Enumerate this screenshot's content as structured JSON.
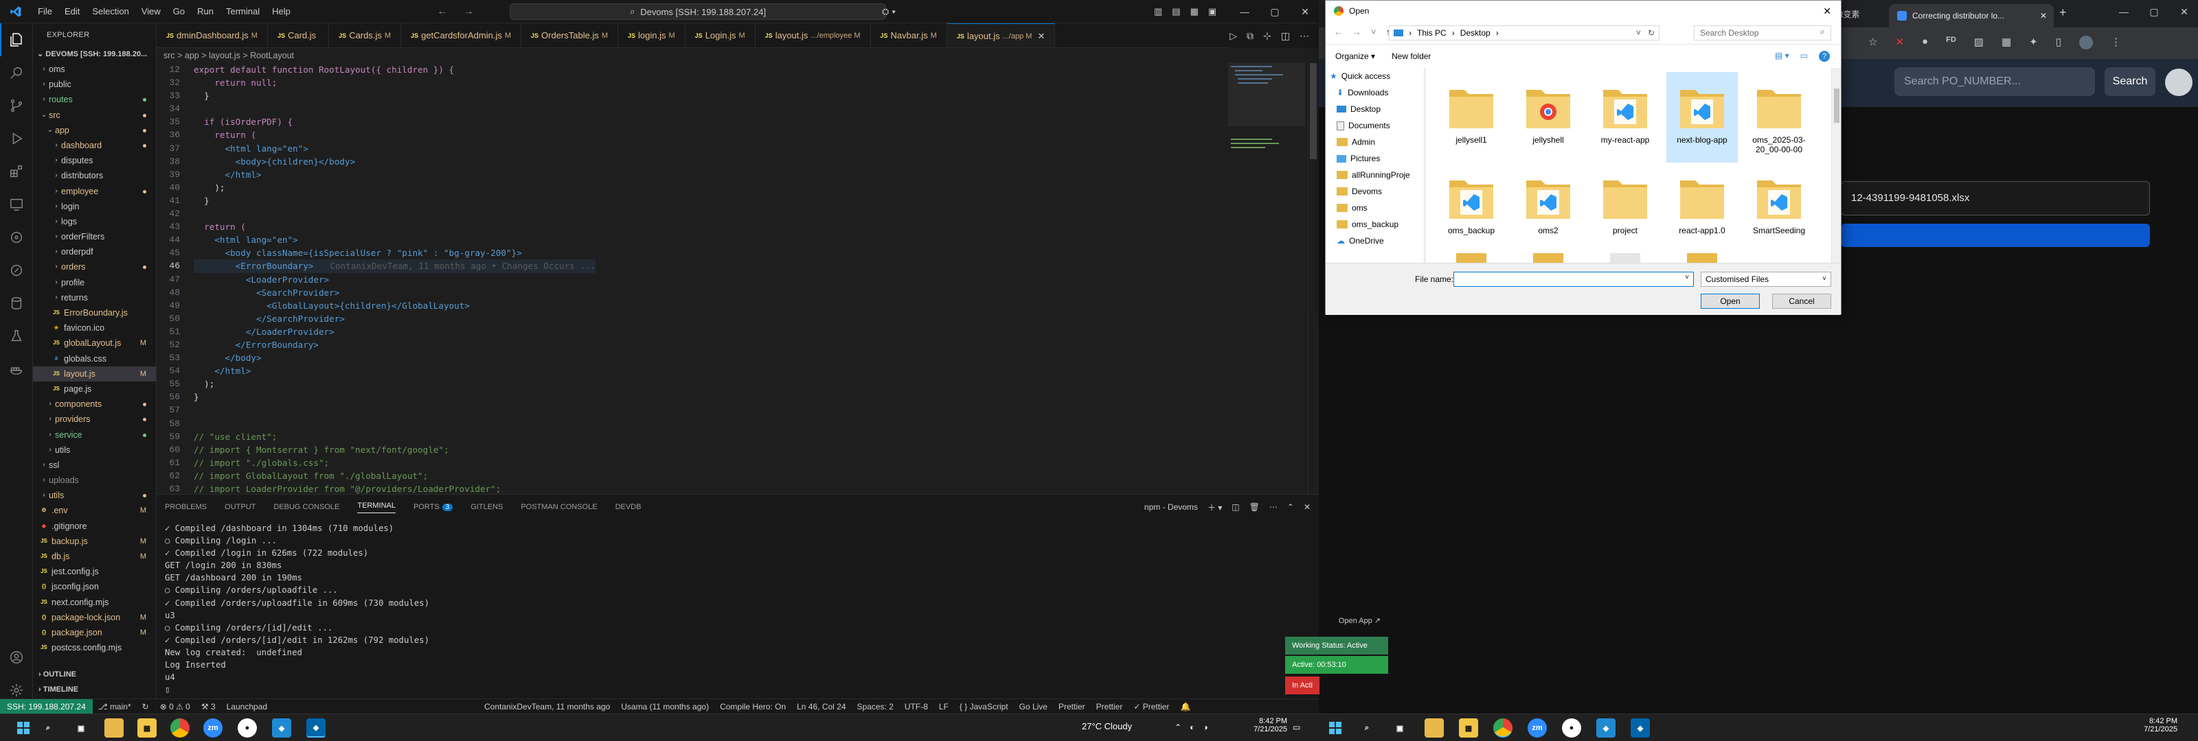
{
  "vscode": {
    "menu": [
      "File",
      "Edit",
      "Selection",
      "View",
      "Go",
      "Run",
      "Terminal",
      "Help"
    ],
    "command_center": "Devoms [SSH: 199.188.207.24]",
    "window_controls": [
      "—",
      "▢",
      "✕"
    ],
    "explorer_header": "EXPLORER",
    "root_label": "DEVOMS [SSH: 199.188.20...",
    "tree": [
      {
        "label": "oms",
        "type": "folder",
        "indent": 1,
        "open": false,
        "color": "#cccccc",
        "badge": ""
      },
      {
        "label": "public",
        "type": "folder",
        "indent": 1,
        "open": false,
        "color": "#cccccc",
        "badge": ""
      },
      {
        "label": "routes",
        "type": "folder",
        "indent": 1,
        "open": false,
        "color": "#73c991",
        "badge": "dot"
      },
      {
        "label": "src",
        "type": "folder",
        "indent": 1,
        "open": true,
        "color": "#e2c08d",
        "badge": "dot"
      },
      {
        "label": "app",
        "type": "folder",
        "indent": 2,
        "open": true,
        "color": "#e2c08d",
        "badge": "dot"
      },
      {
        "label": "dashboard",
        "type": "folder",
        "indent": 3,
        "open": false,
        "color": "#e2c08d",
        "badge": "dot"
      },
      {
        "label": "disputes",
        "type": "folder",
        "indent": 3,
        "open": false,
        "color": "#cccccc",
        "badge": ""
      },
      {
        "label": "distributors",
        "type": "folder",
        "indent": 3,
        "open": false,
        "color": "#cccccc",
        "badge": ""
      },
      {
        "label": "employee",
        "type": "folder",
        "indent": 3,
        "open": false,
        "color": "#e2c08d",
        "badge": "dot"
      },
      {
        "label": "login",
        "type": "folder",
        "indent": 3,
        "open": false,
        "color": "#cccccc",
        "badge": ""
      },
      {
        "label": "logs",
        "type": "folder",
        "indent": 3,
        "open": false,
        "color": "#cccccc",
        "badge": ""
      },
      {
        "label": "orderFilters",
        "type": "folder",
        "indent": 3,
        "open": false,
        "color": "#cccccc",
        "badge": ""
      },
      {
        "label": "orderpdf",
        "type": "folder",
        "indent": 3,
        "open": false,
        "color": "#cccccc",
        "badge": ""
      },
      {
        "label": "orders",
        "type": "folder",
        "indent": 3,
        "open": false,
        "color": "#e2c08d",
        "badge": "dot"
      },
      {
        "label": "profile",
        "type": "folder",
        "indent": 3,
        "open": false,
        "color": "#cccccc",
        "badge": ""
      },
      {
        "label": "returns",
        "type": "folder",
        "indent": 3,
        "open": false,
        "color": "#cccccc",
        "badge": ""
      },
      {
        "label": "ErrorBoundary.js",
        "type": "js",
        "indent": 3,
        "open": false,
        "color": "#e2c08d",
        "badge": ""
      },
      {
        "label": "favicon.ico",
        "type": "ico",
        "indent": 3,
        "open": false,
        "color": "#cccccc",
        "badge": ""
      },
      {
        "label": "globalLayout.js",
        "type": "js",
        "indent": 3,
        "open": false,
        "color": "#e2c08d",
        "badge": "M"
      },
      {
        "label": "globals.css",
        "type": "css",
        "indent": 3,
        "open": false,
        "color": "#cccccc",
        "badge": ""
      },
      {
        "label": "layout.js",
        "type": "js",
        "indent": 3,
        "open": false,
        "color": "#e2c08d",
        "badge": "M",
        "selected": true
      },
      {
        "label": "page.js",
        "type": "js",
        "indent": 3,
        "open": false,
        "color": "#cccccc",
        "badge": ""
      },
      {
        "label": "components",
        "type": "folder",
        "indent": 2,
        "open": false,
        "color": "#e2c08d",
        "badge": "dot"
      },
      {
        "label": "providers",
        "type": "folder",
        "indent": 2,
        "open": false,
        "color": "#e2c08d",
        "badge": "dot"
      },
      {
        "label": "service",
        "type": "folder",
        "indent": 2,
        "open": false,
        "color": "#73c991",
        "badge": "dot"
      },
      {
        "label": "utils",
        "type": "folder",
        "indent": 2,
        "open": false,
        "color": "#cccccc",
        "badge": ""
      },
      {
        "label": "ssl",
        "type": "folder",
        "indent": 1,
        "open": false,
        "color": "#cccccc",
        "badge": ""
      },
      {
        "label": "uploads",
        "type": "folder",
        "indent": 1,
        "open": false,
        "color": "#8c8c8c",
        "badge": ""
      },
      {
        "label": "utils",
        "type": "folder",
        "indent": 1,
        "open": false,
        "color": "#e2c08d",
        "badge": "dot"
      },
      {
        "label": ".env",
        "type": "env",
        "indent": 1,
        "open": false,
        "color": "#e2c08d",
        "badge": "M"
      },
      {
        "label": ".gitignore",
        "type": "git",
        "indent": 1,
        "open": false,
        "color": "#cccccc",
        "badge": ""
      },
      {
        "label": "backup.js",
        "type": "js",
        "indent": 1,
        "open": false,
        "color": "#e2c08d",
        "badge": "M"
      },
      {
        "label": "db.js",
        "type": "js",
        "indent": 1,
        "open": false,
        "color": "#e2c08d",
        "badge": "M"
      },
      {
        "label": "jest.config.js",
        "type": "js",
        "indent": 1,
        "open": false,
        "color": "#cccccc",
        "badge": ""
      },
      {
        "label": "jsconfig.json",
        "type": "json",
        "indent": 1,
        "open": false,
        "color": "#cccccc",
        "badge": ""
      },
      {
        "label": "next.config.mjs",
        "type": "js",
        "indent": 1,
        "open": false,
        "color": "#cccccc",
        "badge": ""
      },
      {
        "label": "package-lock.json",
        "type": "json",
        "indent": 1,
        "open": false,
        "color": "#e2c08d",
        "badge": "M"
      },
      {
        "label": "package.json",
        "type": "json",
        "indent": 1,
        "open": false,
        "color": "#e2c08d",
        "badge": "M"
      },
      {
        "label": "postcss.config.mjs",
        "type": "js",
        "indent": 1,
        "open": false,
        "color": "#cccccc",
        "badge": ""
      }
    ],
    "outline": "OUTLINE",
    "timeline": "TIMELINE",
    "tabs": [
      {
        "label": "dminDashboard.js",
        "badge": "M",
        "active": false
      },
      {
        "label": "Card.js",
        "badge": "",
        "active": false
      },
      {
        "label": "Cards.js",
        "badge": "M",
        "active": false
      },
      {
        "label": "getCardsforAdmin.js",
        "badge": "M",
        "active": false
      },
      {
        "label": "OrdersTable.js",
        "badge": "M",
        "active": false
      },
      {
        "label": "login.js",
        "badge": "M",
        "active": false
      },
      {
        "label": "Login.js",
        "badge": "M",
        "active": false
      },
      {
        "label": "layout.js",
        "badge": ".../employee M",
        "active": false
      },
      {
        "label": "Navbar.js",
        "badge": "M",
        "active": false
      },
      {
        "label": "layout.js",
        "badge": ".../app M",
        "active": true
      }
    ],
    "breadcrumb": "src > app > layout.js > RootLayout",
    "line_numbers": [
      "12",
      "32",
      "33",
      "34",
      "35",
      "36",
      "37",
      "38",
      "39",
      "40",
      "41",
      "42",
      "43",
      "44",
      "45",
      "46",
      "47",
      "48",
      "49",
      "50",
      "51",
      "52",
      "53",
      "54",
      "55",
      "56",
      "57",
      "58",
      "59",
      "60",
      "61",
      "62",
      "63"
    ],
    "code_lines": [
      "export default function RootLayout({ children }) {",
      "    return null;",
      "  }",
      "",
      "  if (isOrderPDF) {",
      "    return (",
      "      <html lang=\"en\">",
      "        <body>{children}</body>",
      "      </html>",
      "    );",
      "  }",
      "",
      "  return (",
      "    <html lang=\"en\">",
      "      <body className={isSpecialUser ? \"pink\" : \"bg-gray-200\"}>",
      "        <ErrorBoundary>",
      "          <LoaderProvider>",
      "            <SearchProvider>",
      "              <GlobalLayout>{children}</GlobalLayout>",
      "            </SearchProvider>",
      "          </LoaderProvider>",
      "        </ErrorBoundary>",
      "      </body>",
      "    </html>",
      "  );",
      "}",
      "",
      "",
      "// \"use client\";",
      "// import { Montserrat } from \"next/font/google\";",
      "// import \"./globals.css\";",
      "// import GlobalLayout from \"./globalLayout\";",
      "// import LoaderProvider from \"@/providers/LoaderProvider\";"
    ],
    "blame_hint": "ContanixDevTeam, 11 months ago • Changes Occurs ...",
    "panel_tabs": [
      "PROBLEMS",
      "OUTPUT",
      "DEBUG CONSOLE",
      "TERMINAL",
      "PORTS",
      "GITLENS",
      "POSTMAN CONSOLE",
      "DEVDB"
    ],
    "ports_count": "3",
    "terminal_name": "npm - Devoms",
    "terminal_lines": [
      "✓ Compiled /dashboard in 1304ms (710 modules)",
      "○ Compiling /login ...",
      "✓ Compiled /login in 626ms (722 modules)",
      "GET /login 200 in 830ms",
      "GET /dashboard 200 in 190ms",
      "○ Compiling /orders/uploadfile ...",
      "✓ Compiled /orders/uploadfile in 609ms (730 modules)",
      "u3",
      "○ Compiling /orders/[id]/edit ...",
      "✓ Compiled /orders/[id]/edit in 1262ms (792 modules)",
      "New log created:  undefined",
      "Log Inserted",
      "u4",
      "▯"
    ],
    "status": {
      "ssh": "SSH: 199.188.207.24",
      "branch": "main*",
      "sync": "↻",
      "errors": "⊗ 0 ⚠ 0",
      "warnings": "⚒ 3",
      "launchpad": "Launchpad",
      "blame": "ContanixDevTeam, 11 months ago",
      "user": "Usama (11 months ago)",
      "compile": "Compile Hero: On",
      "position": "Ln 46, Col 24",
      "spaces": "Spaces: 2",
      "encoding": "UTF-8",
      "eol": "LF",
      "language": "{ } JavaScript",
      "golive": "Go Live",
      "prettier1": "Prettier",
      "prettier2": "Prettier",
      "prettier3": "✓ Prettier"
    }
  },
  "chrome": {
    "tab_title": "Correcting distributor lo...",
    "tab2_title": "t变素",
    "search_placeholder": "Search PO_NUMBER...",
    "search_button": "Search",
    "file_value": "12-4391199-9481058.xlsx",
    "open_app": "Open App ↗",
    "working_status": "Working Status: Active",
    "active_timer": "Active: 00:53:10",
    "in_active": "In Acti",
    "accent": "#0b57d0"
  },
  "dialog": {
    "title": "Open",
    "path": [
      "This PC",
      "Desktop"
    ],
    "search_placeholder": "Search Desktop",
    "organize": "Organize ▾",
    "new_folder": "New folder",
    "nav": [
      "Quick access",
      "Downloads",
      "Desktop",
      "Documents",
      "Admin",
      "Pictures",
      "allRunningProje",
      "Devoms",
      "oms",
      "oms_backup",
      "OneDrive"
    ],
    "files": [
      {
        "label": "jellysell1",
        "kind": "folder"
      },
      {
        "label": "jellyshell",
        "kind": "chrome"
      },
      {
        "label": "my-react-app",
        "kind": "vscode"
      },
      {
        "label": "next-blog-app",
        "kind": "vscode",
        "selected": true
      },
      {
        "label": "oms_2025-03-20_00-00-00",
        "kind": "folder"
      },
      {
        "label": "oms_backup",
        "kind": "vscode"
      },
      {
        "label": "oms2",
        "kind": "vscode"
      },
      {
        "label": "project",
        "kind": "folder"
      },
      {
        "label": "react-app1.0",
        "kind": "folder"
      },
      {
        "label": "SmartSeeding",
        "kind": "vscode"
      }
    ],
    "file_name_label": "File name:",
    "file_name_value": "",
    "filter": "Customised Files",
    "open_button": "Open",
    "cancel_button": "Cancel"
  },
  "taskbar": {
    "weather": "27°C  Cloudy",
    "time": "8:42 PM",
    "date": "7/21/2025",
    "time2": "8:42 PM",
    "date2": "7/21/2025"
  }
}
